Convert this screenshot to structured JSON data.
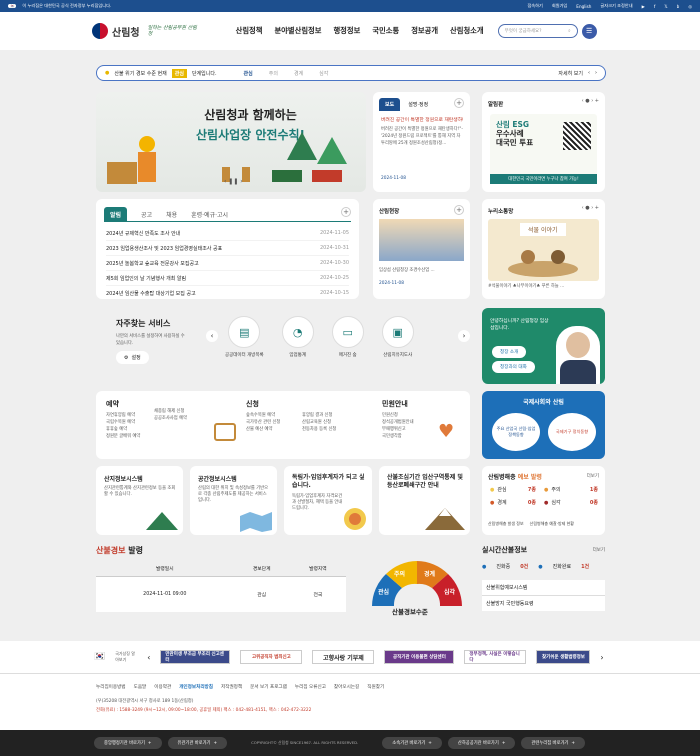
{
  "topbar": {
    "notice": "이 누리집은 대한민국 공식 전자정부 누리집입니다.",
    "links": [
      "접속하기",
      "회원가입",
      "English",
      "글자크기 조정안내"
    ]
  },
  "header": {
    "logo": "산림청",
    "slogan": "일하는 산림공무원 산림청",
    "menu": [
      "산림정책",
      "분야별산림정보",
      "행정정보",
      "국민소통",
      "정보공개",
      "산림청소개"
    ],
    "search_placeholder": "무엇이 궁금하세요?"
  },
  "alert": {
    "text_pre": "산불 위기 경보 수준 현재",
    "level": "관심",
    "text_post": "단계입니다.",
    "steps": [
      "관심",
      "주의",
      "경계",
      "심각"
    ],
    "more": "자세히 보기"
  },
  "hero": {
    "line1": "산림청과 함께하는",
    "line2": "산림사업장 안전수칙!"
  },
  "press": {
    "tabs": [
      "보도",
      "설명·정정"
    ],
    "title": "버려진 공간이 특별한 정원으로 재탄생하다!",
    "body": "버려진 공간이 특별한 정원으로 재탄생하다!\"-'2024년 정원드림 프로젝트'를 통해 지역 자투리땅에 25개 정원조성산림청(정...",
    "date": "2024-11-08"
  },
  "bulletin": {
    "title": "알림판",
    "poster_line1": "산림 ESG",
    "poster_line2": "우수사례",
    "poster_line3": "대국민 투표",
    "poster_footer": "대한민국 국민이라면 누구나 참여 가능!"
  },
  "notice": {
    "tabs": [
      "알림",
      "공고",
      "채용",
      "훈령·예규·고시"
    ],
    "items": [
      {
        "t": "2024년 규제혁신 만족도 조사 안내",
        "d": "2024-11-05"
      },
      {
        "t": "2023 임업용생산조사 및 2023 임업경영실태조사 공표",
        "d": "2024-10-31"
      },
      {
        "t": "2025년 놀봄학교 숲교육 전문강사 모집공고",
        "d": "2024-10-30"
      },
      {
        "t": "제5회 임업인의 날 기념행사 개최 알림",
        "d": "2024-10-25"
      },
      {
        "t": "2024년 임산물 수출탑 대상기업 모집 공고",
        "d": "2024-10-15"
      }
    ]
  },
  "field": {
    "title": "산림현장",
    "caption": "임상섭 산림청장 조경수산업 ...",
    "date": "2024-11-08"
  },
  "sns": {
    "title": "누리소통망",
    "sign": "석물 이야기",
    "caption": "#석물이야기 ♣나무이야기♣ 푸른 하늘 ..."
  },
  "services": {
    "title": "자주찾는 서비스",
    "desc": "나만의 서비스를 설정하여 사용하실 수 있습니다.",
    "setting": "설정",
    "items": [
      "공공데이터 개방목록",
      "임업통계",
      "매거진 숲",
      "산림치유지도사"
    ]
  },
  "chief": {
    "greet": "안녕하십니까? 산림청장 임상섭입니다.",
    "btn1": "청장 소개",
    "btn2": "청장과의 대화"
  },
  "categories": {
    "reserve": {
      "title": "예약",
      "items": [
        "자연휴양림 예약",
        "국립수목원 예약",
        "휴휴숲 예약",
        "정원분 글배워 예약"
      ]
    },
    "apply": {
      "title": "신청",
      "items": [
        "채종림 해제 신청",
        "공공조사사업 예약",
        "숲속수목원 예약",
        "휴양림 결과 신청",
        "국가유산 관련 신청",
        "산림교육원 신청",
        "산불 예산 예약",
        "천동차용 등록 신청"
      ]
    },
    "civil": {
      "title": "민원안내",
      "items": [
        "민원신청",
        "정석공개법원안내",
        "부패행위신고",
        "국민생각함"
      ]
    }
  },
  "intl": {
    "title": "국제사회와 산림",
    "b1": "주요 산업국 산림·임업 정책동향",
    "b2": "국제기구 정치동향"
  },
  "systems": [
    {
      "title": "산지정보시스템",
      "desc": "산지관련통계와 산지관련정보 등을 조회 할 수 있습니다."
    },
    {
      "title": "공간정보시스템",
      "desc": "산림의 대한 위치 및 속성정보를 기반으로 각종 산림주제도를 제공하는 서비스입니다."
    },
    {
      "title": "독림가·임업후계자가 되고 싶습니다.",
      "desc": "독림가·임업후계자 자격요건과 선발절차, 혜택 등을 안내드립니다."
    },
    {
      "title": "산불조심기간 입산구역통제 및 등산로폐쇄구간 안내",
      "desc": ""
    }
  ],
  "pest": {
    "title": "산림병해충",
    "title2": "예보 발령",
    "more": "더보기",
    "rows": [
      {
        "a": "관심",
        "av": "7종",
        "b": "주의",
        "bv": "1종"
      },
      {
        "a": "경계",
        "av": "0종",
        "b": "심각",
        "bv": "0종"
      }
    ],
    "links": [
      "산림병해충 발생 정보",
      "산림병해충 예찰·방제 현황"
    ]
  },
  "fire": {
    "title_red": "산불경보",
    "title": "발령",
    "cols": [
      "발령일시",
      "경보단계",
      "발령지역"
    ],
    "row": {
      "date": "2024-11-01 09:00",
      "level": "관심",
      "area": "전국"
    },
    "gauge_labels": [
      "관심",
      "주의",
      "경계",
      "심각"
    ],
    "gauge_title": "산불경보수준"
  },
  "firestat": {
    "title": "실시간산불정보",
    "more": "더보기",
    "a": "진화중",
    "av": "0건",
    "b": "진화완료",
    "bv": "1건",
    "links": [
      "산불위험예보시스템",
      "산불방지 국민행동요령"
    ]
  },
  "banners": {
    "title": "국가상징 알아보기",
    "items": [
      "만관미생 부조금 부조리 신고센터",
      "고위공직자 범죄신고",
      "고향사랑 기부제",
      "공직기관 이용불편 상담센터",
      "정부정책, 사실은 이렇습니다",
      "찾기쉬운 생활법령정보"
    ]
  },
  "footer": {
    "links": [
      "누리집이용방법",
      "도움말",
      "이용약관",
      "개인정보처리방침",
      "저작권정책",
      "문서 보기 프로그램",
      "누리집 오류신고",
      "찾아오시는길",
      "직원찾기"
    ],
    "address": "(우)35208 대전광역시 서구 청사로 189 1동(산림청)",
    "phone": "전화(유료) : 1588-3249 (9시~12시, 09:00~18:00, 공휴일 제외) 팩스 : 042-481-4151, 팩스 : 042-472-3222",
    "copyright": "COPYRIGHT© 산림청 SINCE1967. ALL RIGHTS RESERVED.",
    "btns": [
      "중앙행정기관 바로가기",
      "유관기관 바로가기",
      "소속기관 바로가기",
      "산하공공기관 바로가기",
      "관련누리집 바로가기"
    ]
  }
}
